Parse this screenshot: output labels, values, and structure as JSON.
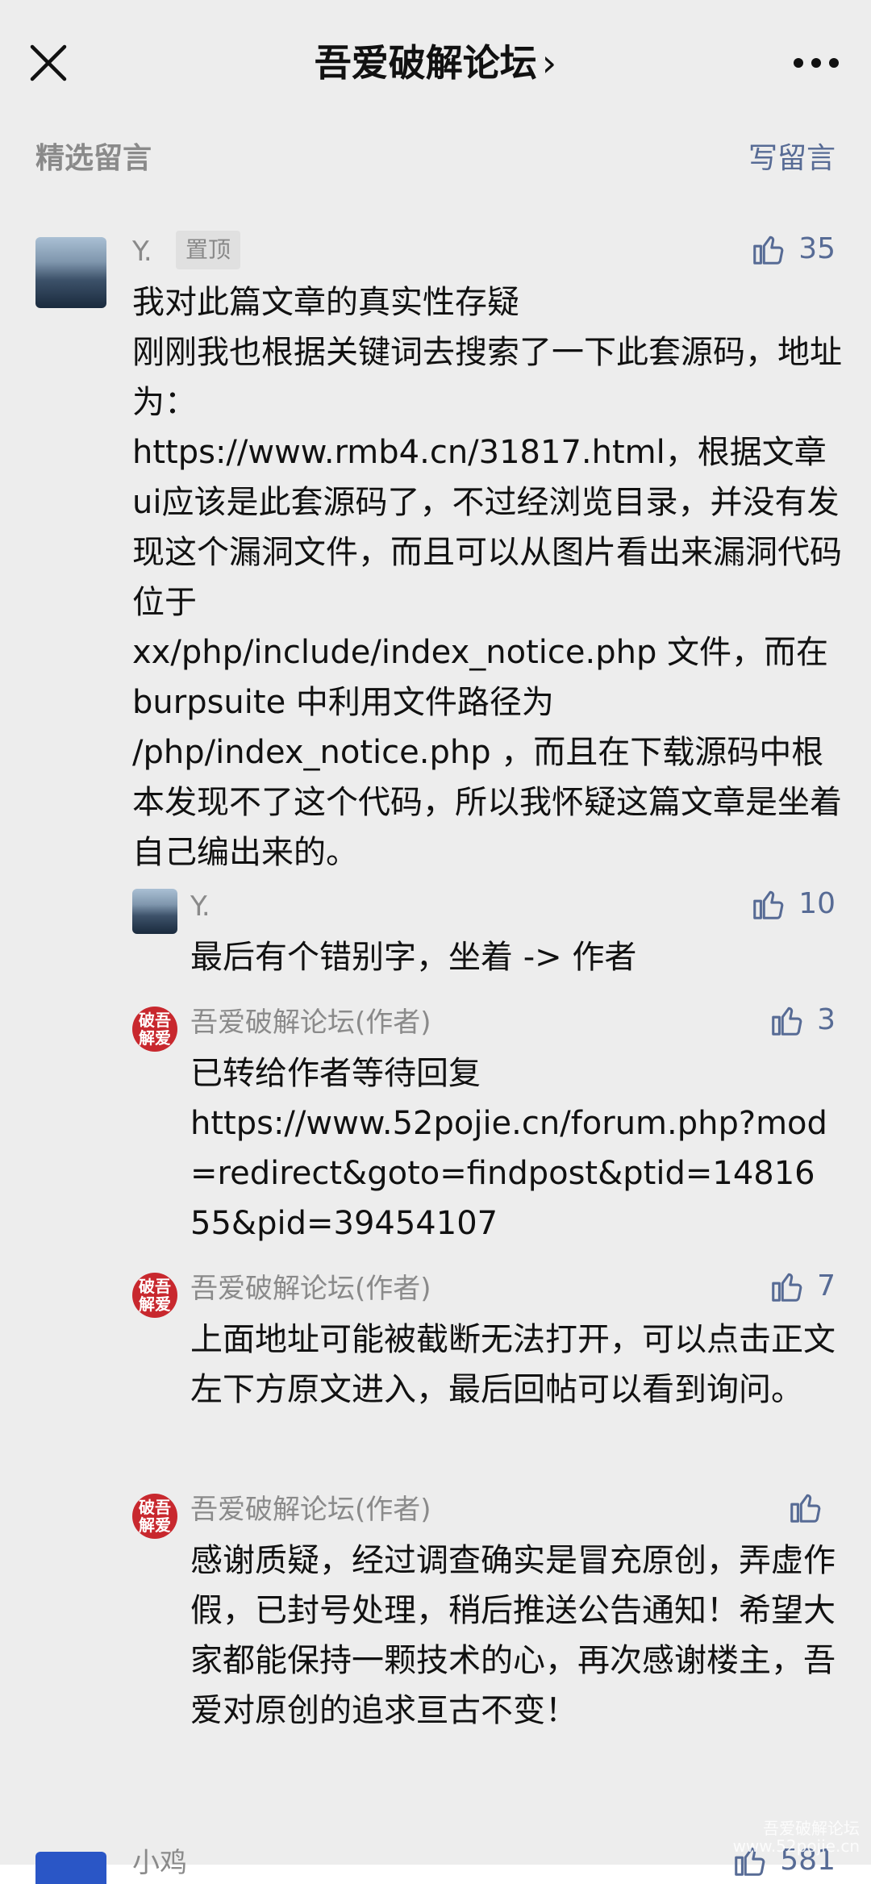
{
  "nav": {
    "title": "吾爱破解论坛",
    "title_chevron": "›"
  },
  "section": {
    "title": "精选留言",
    "write_label": "写留言"
  },
  "comments": [
    {
      "name": "Y.",
      "badge": "置顶",
      "likes": "35",
      "text": "我对此篇文章的真实性存疑\n刚刚我也根据关键词去搜索了一下此套源码，地址为：\nhttps://www.rmb4.cn/31817.html，根据文章ui应该是此套源码了，不过经浏览目录，并没有发现这个漏洞文件，而且可以从图片看出来漏洞代码位于\nxx/php/include/index_notice.php 文件，而在 burpsuite 中利用文件路径为\n/php/index_notice.php ，而且在下载源码中根本发现不了这个代码，所以我怀疑这篇文章是坐着自己编出来的。"
    }
  ],
  "replies": [
    {
      "name": "Y.",
      "likes": "10",
      "text": "最后有个错别字，坐着 -> 作者"
    },
    {
      "name": "吾爱破解论坛(作者)",
      "seal": "破吾\n解爱",
      "likes": "3",
      "text": "已转给作者等待回复\nhttps://www.52pojie.cn/forum.php?mod=redirect&goto=findpost&ptid=1481655&pid=39454107"
    },
    {
      "name": "吾爱破解论坛(作者)",
      "seal": "破吾\n解爱",
      "likes": "7",
      "text": "上面地址可能被截断无法打开，可以点击正文左下方原文进入，最后回帖可以看到询问。"
    },
    {
      "name": "吾爱破解论坛(作者)",
      "seal": "破吾\n解爱",
      "likes": "",
      "text": "感谢质疑，经过调查确实是冒充原创，弄虚作假，已封号处理，稍后推送公告通知！希望大家都能保持一颗技术的心，再次感谢楼主，吾爱对原创的追求亘古不变！"
    }
  ],
  "next_comment": {
    "name": "小鸡",
    "likes": "581"
  },
  "watermark": {
    "line1": "吾爱破解论坛",
    "line2": "www.52pojie.cn"
  },
  "colors": {
    "link_blue": "#576b95",
    "background": "#ededed",
    "seal_red": "#c8282e"
  }
}
